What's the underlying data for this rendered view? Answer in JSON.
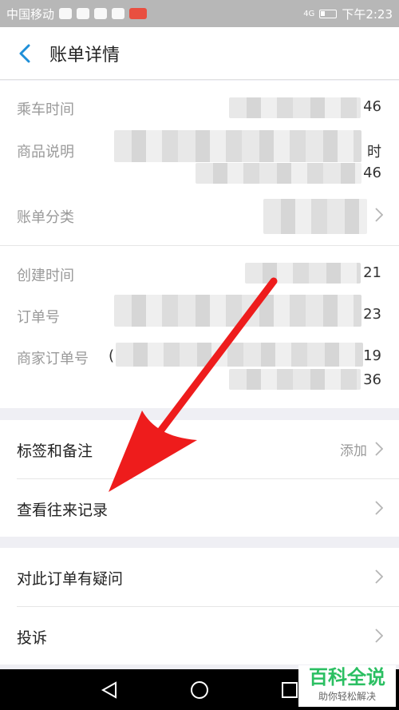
{
  "status_bar": {
    "carrier": "中国移动",
    "network": "4G",
    "time": "下午2:23"
  },
  "header": {
    "title": "账单详情",
    "back_icon": "chevron-left-icon",
    "accent": "#1e8fd8"
  },
  "details": [
    {
      "label": "乘车时间",
      "value": "46"
    },
    {
      "label": "商品说明",
      "value_line1": "时",
      "value_line2": "46"
    },
    {
      "label": "账单分类",
      "value": ""
    },
    {
      "label": "创建时间",
      "value": "21"
    },
    {
      "label": "订单号",
      "value": "23"
    },
    {
      "label": "商家订单号",
      "prefix": "(",
      "value_line1": "19",
      "value_line2": "36"
    }
  ],
  "actions": {
    "tags": {
      "label": "标签和备注",
      "hint": "添加"
    },
    "history": {
      "label": "查看往来记录"
    },
    "dispute": {
      "label": "对此订单有疑问"
    },
    "complain": {
      "label": "投诉"
    }
  },
  "annotation": {
    "arrow_color": "#ee1c1c"
  },
  "watermark": {
    "title": "百科全说",
    "subtitle": "助你轻松解决"
  }
}
